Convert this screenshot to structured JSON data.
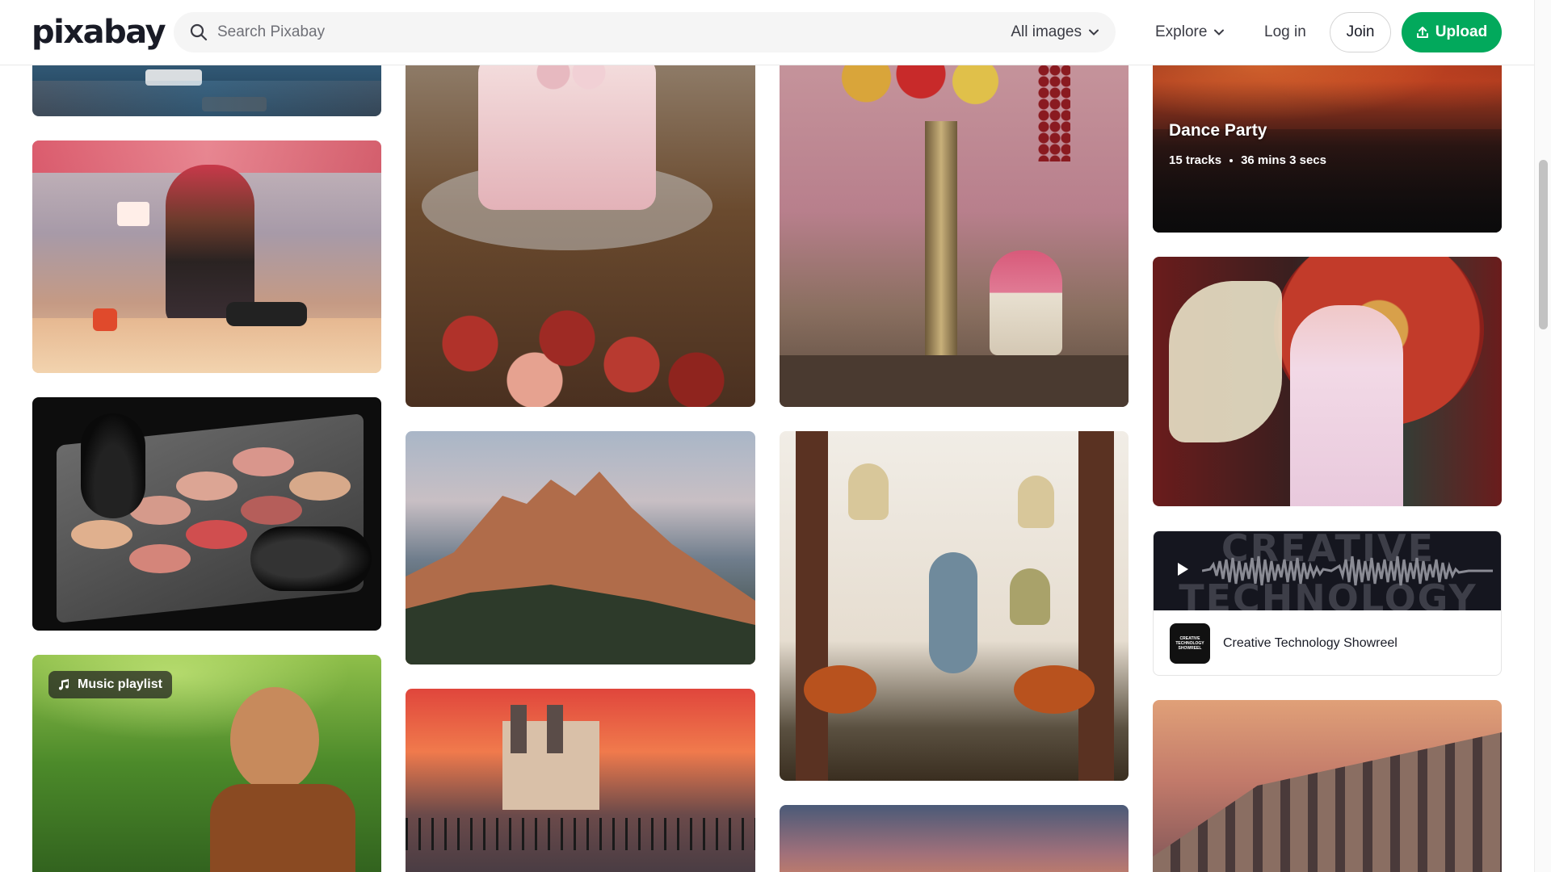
{
  "header": {
    "logo": "pixabay",
    "search_placeholder": "Search Pixabay",
    "filter_label": "All images",
    "explore_label": "Explore",
    "login_label": "Log in",
    "join_label": "Join",
    "upload_label": "Upload"
  },
  "tiles": {
    "dance_party": {
      "title": "Dance Party",
      "tracks": "15 tracks",
      "duration": "36 mins 3 secs"
    },
    "music_playlist_badge": "Music playlist",
    "audio": {
      "bg_line1": "CREATIVE",
      "bg_line2": "TECHNOLOGY",
      "thumb_text": [
        "CREATIVE",
        "TECHNOLOGY",
        "SHOWREEL"
      ],
      "title": "Creative Technology Showreel"
    }
  },
  "colors": {
    "brand_green": "#02a95c",
    "text": "#191b26"
  },
  "icons": {
    "search": "search-icon",
    "chevron": "chevron-down-icon",
    "upload": "upload-icon",
    "music": "music-note-icon",
    "play": "play-icon"
  }
}
